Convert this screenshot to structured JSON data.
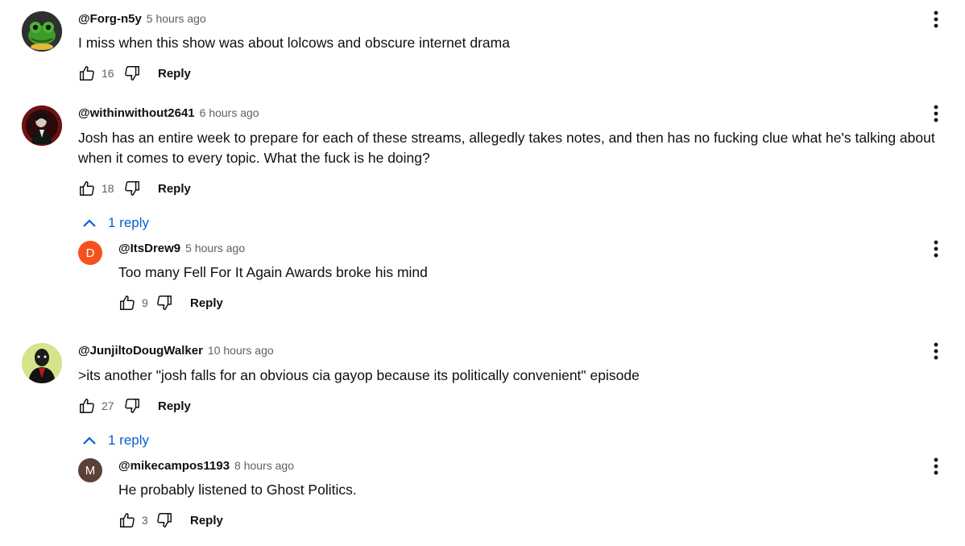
{
  "comments": [
    {
      "author": "@Forg-n5y",
      "time": "5 hours ago",
      "text": "I miss when this show was about lolcows and obscure internet drama",
      "likes": "16",
      "reply_label": "Reply",
      "avatar_icon": "frog-avatar"
    },
    {
      "author": "@withinwithout2641",
      "time": "6 hours ago",
      "text_line1": "Josh has an entire week to prepare for each of these streams, allegedly takes notes, and then has no fucking clue what he's talking about",
      "text_line2": "when it comes to every topic. What the fuck is he doing?",
      "likes": "18",
      "reply_label": "Reply",
      "avatar_icon": "dark-figure-avatar",
      "replies_toggle": "1 reply",
      "replies": [
        {
          "author": "@ItsDrew9",
          "time": "5 hours ago",
          "text": "Too many Fell For It Again Awards broke his mind",
          "likes": "9",
          "reply_label": "Reply",
          "avatar_letter": "D",
          "avatar_color": "#f4511e"
        }
      ]
    },
    {
      "author": "@JunjiltoDougWalker",
      "time": "10 hours ago",
      "text": ">its another \"josh falls for an obvious cia gayop because its politically convenient\" episode",
      "likes": "27",
      "reply_label": "Reply",
      "avatar_icon": "masked-figure-avatar",
      "replies_toggle": "1 reply",
      "replies": [
        {
          "author": "@mikecampos1193",
          "time": "8 hours ago",
          "text": "He probably listened to Ghost Politics.",
          "likes": "3",
          "reply_label": "Reply",
          "avatar_letter": "M",
          "avatar_color": "#5d4037"
        }
      ]
    }
  ],
  "colors": {
    "link_blue": "#065fd4",
    "secondary_text": "#606060",
    "primary_text": "#0f0f0f"
  }
}
